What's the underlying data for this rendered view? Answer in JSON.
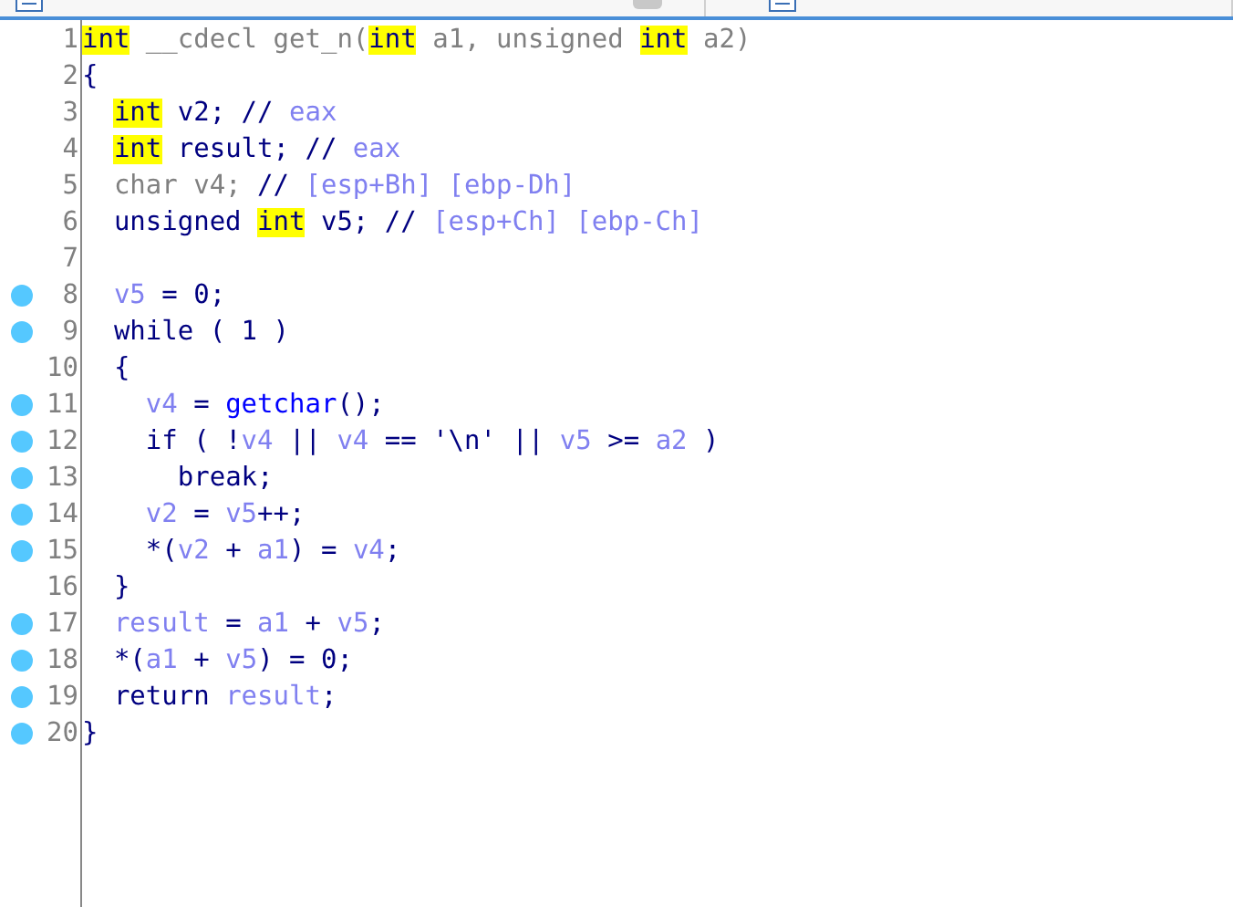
{
  "lines": [
    {
      "number": "1",
      "marked": false,
      "tokens": [
        {
          "kind": "hl",
          "text": "int"
        },
        {
          "kind": "dim",
          "text": " __cdecl get_n("
        },
        {
          "kind": "hl",
          "text": "int"
        },
        {
          "kind": "dim",
          "text": " a1, unsigned "
        },
        {
          "kind": "hl",
          "text": "int"
        },
        {
          "kind": "dim",
          "text": " a2)"
        }
      ]
    },
    {
      "number": "2",
      "marked": false,
      "tokens": [
        {
          "kind": "key",
          "text": "{"
        }
      ],
      "children": [
        {
          "number": "3",
          "marked": false,
          "tokens": [
            {
              "kind": "hl",
              "text": "int"
            },
            {
              "kind": "key",
              "text": " v2; // "
            },
            {
              "kind": "var",
              "text": "eax"
            }
          ]
        },
        {
          "number": "4",
          "marked": false,
          "tokens": [
            {
              "kind": "hl",
              "text": "int"
            },
            {
              "kind": "key",
              "text": " result; // "
            },
            {
              "kind": "var",
              "text": "eax"
            }
          ]
        },
        {
          "number": "5",
          "marked": false,
          "tokens": [
            {
              "kind": "dim",
              "text": "char v4; "
            },
            {
              "kind": "key",
              "text": "// "
            },
            {
              "kind": "var",
              "text": "[esp+Bh] [ebp-Dh]"
            }
          ]
        },
        {
          "number": "6",
          "marked": false,
          "tokens": [
            {
              "kind": "key",
              "text": "unsigned "
            },
            {
              "kind": "hl",
              "text": "int"
            },
            {
              "kind": "key",
              "text": " v5; // "
            },
            {
              "kind": "var",
              "text": "[esp+Ch] [ebp-Ch]"
            }
          ]
        },
        {
          "number": "7",
          "marked": false
        },
        {
          "number": "8",
          "marked": true,
          "tokens": [
            {
              "kind": "var",
              "text": "v5"
            },
            {
              "kind": "key",
              "text": " = 0;"
            }
          ]
        },
        {
          "number": "9",
          "marked": true,
          "tokens": [
            {
              "kind": "key",
              "text": "while ( 1 )"
            }
          ]
        },
        {
          "number": "10",
          "marked": false,
          "tokens": [
            {
              "kind": "key",
              "text": "{"
            }
          ],
          "children": [
            {
              "number": "11",
              "marked": true,
              "tokens": [
                {
                  "kind": "var",
                  "text": "v4"
                },
                {
                  "kind": "key",
                  "text": " = "
                },
                {
                  "kind": "func",
                  "text": "getchar"
                },
                {
                  "kind": "key",
                  "text": "();"
                }
              ]
            },
            {
              "number": "12",
              "marked": true,
              "tokens": [
                {
                  "kind": "key",
                  "text": "if ( !"
                },
                {
                  "kind": "var",
                  "text": "v4"
                },
                {
                  "kind": "key",
                  "text": " || "
                },
                {
                  "kind": "var",
                  "text": "v4"
                },
                {
                  "kind": "key",
                  "text": " == '\\n' || "
                },
                {
                  "kind": "var",
                  "text": "v5"
                },
                {
                  "kind": "key",
                  "text": " >= "
                },
                {
                  "kind": "var",
                  "text": "a2"
                },
                {
                  "kind": "key",
                  "text": " )"
                }
              ],
              "children": [
                {
                  "number": "13",
                  "marked": true,
                  "tokens": [
                    {
                      "kind": "key",
                      "text": "break;"
                    }
                  ]
                }
              ]
            },
            {
              "number": "14",
              "marked": true,
              "tokens": [
                {
                  "kind": "var",
                  "text": "v2"
                },
                {
                  "kind": "key",
                  "text": " = "
                },
                {
                  "kind": "var",
                  "text": "v5"
                },
                {
                  "kind": "key",
                  "text": "++;"
                }
              ]
            },
            {
              "number": "15",
              "marked": true,
              "tokens": [
                {
                  "kind": "key",
                  "text": "*("
                },
                {
                  "kind": "var",
                  "text": "v2"
                },
                {
                  "kind": "key",
                  "text": " + "
                },
                {
                  "kind": "var",
                  "text": "a1"
                },
                {
                  "kind": "key",
                  "text": ") = "
                },
                {
                  "kind": "var",
                  "text": "v4"
                },
                {
                  "kind": "key",
                  "text": ";"
                }
              ]
            }
          ]
        },
        {
          "number": "16",
          "marked": false,
          "tokens": [
            {
              "kind": "key",
              "text": "}"
            }
          ]
        },
        {
          "number": "17",
          "marked": true,
          "tokens": [
            {
              "kind": "var",
              "text": "result"
            },
            {
              "kind": "key",
              "text": " = "
            },
            {
              "kind": "var",
              "text": "a1"
            },
            {
              "kind": "key",
              "text": " + "
            },
            {
              "kind": "var",
              "text": "v5"
            },
            {
              "kind": "key",
              "text": ";"
            }
          ]
        },
        {
          "number": "18",
          "marked": true,
          "tokens": [
            {
              "kind": "key",
              "text": "*("
            },
            {
              "kind": "var",
              "text": "a1"
            },
            {
              "kind": "key",
              "text": " + "
            },
            {
              "kind": "var",
              "text": "v5"
            },
            {
              "kind": "key",
              "text": ") = 0;"
            }
          ]
        },
        {
          "number": "19",
          "marked": true,
          "tokens": [
            {
              "kind": "key",
              "text": "return "
            },
            {
              "kind": "var",
              "text": "result"
            },
            {
              "kind": "key",
              "text": ";"
            }
          ]
        }
      ]
    },
    {
      "number": "20",
      "marked": true,
      "tokens": [
        {
          "kind": "key",
          "text": "}"
        }
      ]
    }
  ]
}
